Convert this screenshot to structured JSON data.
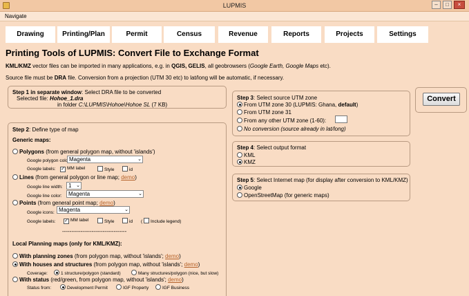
{
  "window": {
    "title": "LUPMIS"
  },
  "menu": {
    "navigate": "Navigate"
  },
  "tabs": [
    "Drawing",
    "Printing/Plan",
    "Permit",
    "Census",
    "Revenue",
    "Reports",
    "Projects",
    "Settings"
  ],
  "page": {
    "heading": "Printing Tools of LUPMIS: Convert File to Exchange Format",
    "intro1_pre": "KML/KMZ",
    "intro1_mid": " vector files can be imported in many applications, e.g. in ",
    "intro1_apps": "QGIS, GELIS",
    "intro1_post": ", all geobrowsers (",
    "intro1_ge": "Google Earth, Google Maps",
    "intro1_end": " etc).",
    "intro2_pre": "Source file must be ",
    "intro2_dra": "DRA",
    "intro2_post": " file. Conversion from a projection (UTM 30 etc) to lat/long will be automatic, if necessary."
  },
  "step1": {
    "title_bold": "Step 1 in separate window",
    "title_rest": ": Select DRA file to be converted",
    "selected_label": "Selected file:",
    "selected_file": "Hohoe_1.dra",
    "folder_label": "in folder",
    "folder_path": "C:\\LUPMIS\\Hohoe\\Hohoe SL",
    "file_size": "(7 KB)"
  },
  "step2": {
    "title_bold": "Step 2",
    "title_rest": ": Define type of map",
    "generic_maps": "Generic maps:",
    "polygons_bold": "Polygons",
    "polygons_rest": " (from general polygon map, without 'islands')",
    "polygon_color_label": "Google polygon color:",
    "polygon_color_value": "Magenta",
    "google_labels_label": "Google labels:",
    "mm_label": "MM label",
    "style_label": "Style",
    "id_label": "id",
    "lines_bold": "Lines",
    "lines_rest": " (from general polygon or line map; ",
    "demo": "demo",
    "line_width_label": "Google line width:",
    "line_width_value": "1",
    "line_color_label": "Google line color:",
    "line_color_value": "Magenta",
    "points_bold": "Points",
    "points_rest": " (from general point map; ",
    "icons_label": "Google icons:",
    "icons_value": "Magenta",
    "include_legend": "Include legend",
    "separator": "-----------------------------------",
    "local_planning": "Local Planning maps (only for KML/KMZ):",
    "zones_bold": "With planning zones",
    "zones_rest": " (from polygon map, without 'islands'; ",
    "houses_bold": "With houses and structures",
    "houses_rest": " (from polygon map, without 'islands'; ",
    "coverage_label": "Coverage:",
    "coverage_opt1": "1 structure/polygon (standard)",
    "coverage_opt2": "Many structures/polygon (nice, but slow)",
    "status_bold": "With status",
    "status_rest": " (red/green, from polygon map, without 'islands'; ",
    "status_from_label": "Status from:",
    "status_opt1": "Development Permit",
    "status_opt2": "IGF Property",
    "status_opt3": "IGF Business"
  },
  "step3": {
    "title_bold": "Step 3",
    "title_rest": ": Select source UTM zone",
    "opt1_pre": "From UTM zone 30 (LUPMIS: Ghana, ",
    "opt1_default": "default",
    "opt1_post": ")",
    "opt2": "From UTM zone 31",
    "opt3": "From any other UTM zone (1-60):",
    "opt4": "No conversion (source already in lat/long)"
  },
  "step4": {
    "title_bold": "Step 4",
    "title_rest": ": Select output format",
    "opt_kml": "KML",
    "opt_kmz": "KMZ"
  },
  "step5": {
    "title_bold": "Step 5",
    "title_rest": ": Select Internet map (for display after conversion to KML/KMZ)",
    "opt_google": "Google",
    "opt_osm": "OpenStreetMap (for generic maps)"
  },
  "convert_button": "Convert"
}
